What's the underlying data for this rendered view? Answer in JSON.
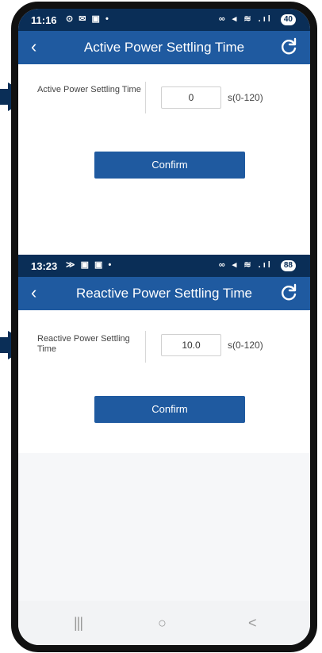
{
  "top_screen": {
    "status": {
      "time": "11:16",
      "icons": "⊙ ✉ ▣ •",
      "system": "∞ ◂ ≋ .ıl",
      "battery": "40"
    },
    "header": {
      "back_icon": "chevron-left",
      "title": "Active Power Settling Time",
      "refresh_icon": "refresh"
    },
    "field": {
      "label": "Active Power Settling Time",
      "value": "0",
      "range": "s(0-120)"
    },
    "confirm_label": "Confirm"
  },
  "bottom_screen": {
    "status": {
      "time": "13:23",
      "icons": "≫ ▣ ▣ •",
      "system": "∞ ◂ ≋ .ıl",
      "battery": "88"
    },
    "header": {
      "back_icon": "chevron-left",
      "title": "Reactive Power Settling Time",
      "refresh_icon": "refresh"
    },
    "field": {
      "label": "Reactive Power Settling Time",
      "value": "10.0",
      "range": "s(0-120)"
    },
    "confirm_label": "Confirm"
  },
  "nav": {
    "recents": "|||",
    "home": "○",
    "back": "<"
  },
  "colors": {
    "header": "#1f5aa0",
    "status_bar": "#0a2e57",
    "button": "#1f5aa0"
  }
}
